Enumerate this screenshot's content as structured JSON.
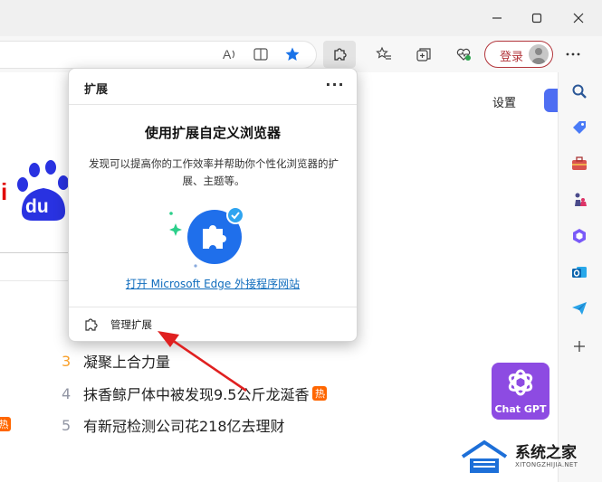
{
  "toolbar": {
    "login_label": "登录"
  },
  "page": {
    "settings_label": "设置",
    "logo_text_left": "i",
    "logo_text_du": "du",
    "left_badge": "热",
    "hot_list": [
      {
        "rank": "3",
        "title": "凝聚上合力量",
        "badge": ""
      },
      {
        "rank": "4",
        "title": "抹香鲸尸体中被发现9.5公斤龙涎香",
        "badge": "热"
      },
      {
        "rank": "5",
        "title": "有新冠检测公司花218亿去理财",
        "badge": ""
      }
    ],
    "chatgpt_label": "Chat GPT"
  },
  "popup": {
    "title": "扩展",
    "more": "···",
    "heading": "使用扩展自定义浏览器",
    "description": "发现可以提高你的工作效率并帮助你个性化浏览器的扩展、主题等。",
    "link": "打开 Microsoft Edge 外接程序网站",
    "manage_label": "管理扩展"
  },
  "watermark": {
    "title": "系统之家",
    "subtitle": "XITONGZHIJIA.NET"
  },
  "colors": {
    "accent_blue": "#0f6cbd",
    "login_red": "#b2353b",
    "baidu_red": "#e10602",
    "baidu_blue": "#2932e1",
    "hot_orange": "#ff6600"
  }
}
